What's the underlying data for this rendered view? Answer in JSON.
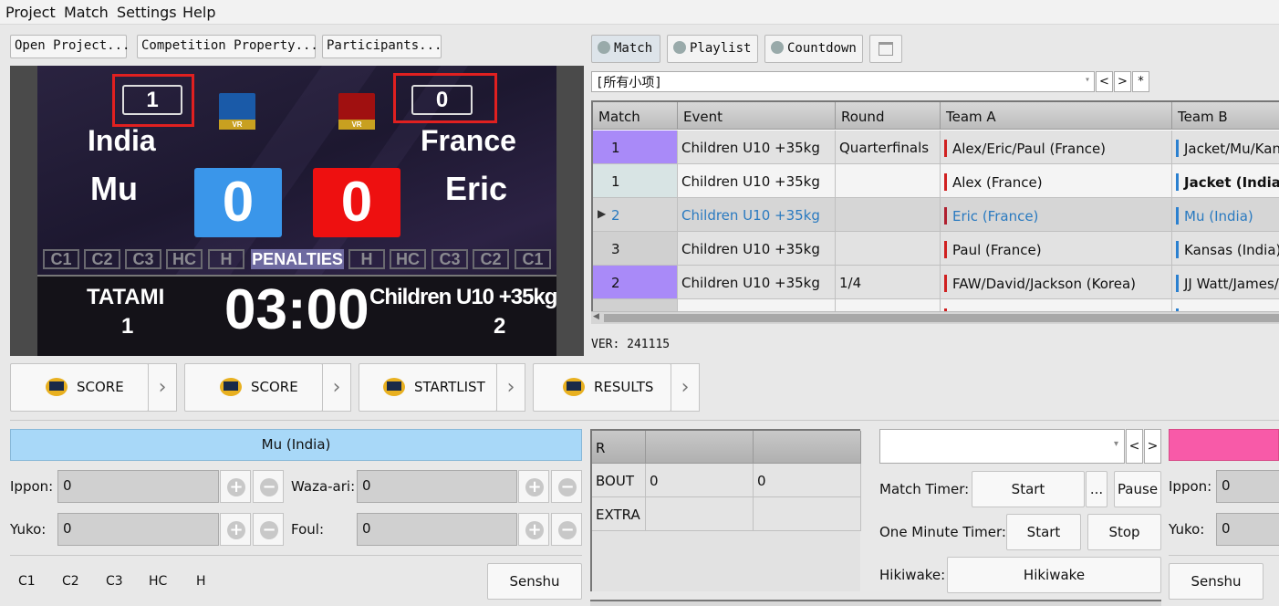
{
  "menu": [
    "Project",
    "Match",
    "Settings",
    "Help"
  ],
  "top_buttons": {
    "open_project": "Open Project...",
    "competition_property": "Competition Property...",
    "participants": "Participants..."
  },
  "scoreboard": {
    "box_left": "1",
    "box_right": "0",
    "flag_label": "VR",
    "team_left": "India",
    "team_right": "France",
    "player_left": "Mu",
    "player_right": "Eric",
    "score_left": "0",
    "score_right": "0",
    "penalties": [
      "C1",
      "C2",
      "C3",
      "HC",
      "H"
    ],
    "penalties_label": "PENALTIES",
    "tatami_label": "TATAMI",
    "tatami_num": "1",
    "clock": "03:00",
    "category": "Children U10 +35kg",
    "category_num": "2",
    "colors": {
      "blue": "#3a96ea",
      "red": "#ee1010"
    }
  },
  "toolbar": {
    "match": "Match",
    "playlist": "Playlist",
    "countdown": "Countdown"
  },
  "filter": {
    "value": "[所有小项]",
    "prev": "<",
    "next": ">",
    "star": "*"
  },
  "table": {
    "headers": [
      "Match",
      "Event",
      "Round",
      "Team A",
      "Team B"
    ],
    "rows": [
      {
        "match": "1",
        "event": "Children U10 +35kg",
        "round": "Quarterfinals",
        "team_a": "Alex/Eric/Paul (France)",
        "team_b": "Jacket/Mu/Kan"
      },
      {
        "match": "1",
        "event": "Children U10 +35kg",
        "round": "",
        "team_a": "Alex (France)",
        "team_b": "Jacket (India)"
      },
      {
        "match": "2",
        "event": "Children U10 +35kg",
        "round": "",
        "team_a": "Eric (France)",
        "team_b": "Mu (India)"
      },
      {
        "match": "3",
        "event": "Children U10 +35kg",
        "round": "",
        "team_a": "Paul (France)",
        "team_b": "Kansas (India)"
      },
      {
        "match": "2",
        "event": "Children U10 +35kg",
        "round": "1/4",
        "team_a": "FAW/David/Jackson (Korea)",
        "team_b": "JJ Watt/James/"
      }
    ]
  },
  "version": "VER: 241115",
  "displays": [
    {
      "label": "SCORE"
    },
    {
      "label": "SCORE"
    },
    {
      "label": "STARTLIST"
    },
    {
      "label": "RESULTS"
    }
  ],
  "athlete_a": {
    "name": "Mu (India)",
    "ippon_label": "Ippon:",
    "ippon": "0",
    "wazaari_label": "Waza-ari:",
    "wazaari": "0",
    "yuko_label": "Yuko:",
    "yuko": "0",
    "foul_label": "Foul:",
    "foul": "0",
    "penalties": [
      "C1",
      "C2",
      "C3",
      "HC",
      "H"
    ],
    "senshu": "Senshu"
  },
  "bout_grid": {
    "header": "R",
    "rows": [
      {
        "label": "BOUT",
        "a": "0",
        "b": "0"
      },
      {
        "label": "EXTRA",
        "a": "",
        "b": ""
      }
    ]
  },
  "timers": {
    "nav_prev": "<",
    "nav_next": ">",
    "match_timer_label": "Match Timer:",
    "start": "Start",
    "more": "...",
    "pause": "Pause",
    "one_minute_label": "One Minute Timer:",
    "start2": "Start",
    "stop": "Stop",
    "hikiwake_label": "Hikiwake:",
    "hikiwake": "Hikiwake"
  },
  "athlete_b": {
    "ippon_label": "Ippon:",
    "ippon": "0",
    "yuko_label": "Yuko:",
    "yuko": "0",
    "senshu": "Senshu"
  }
}
